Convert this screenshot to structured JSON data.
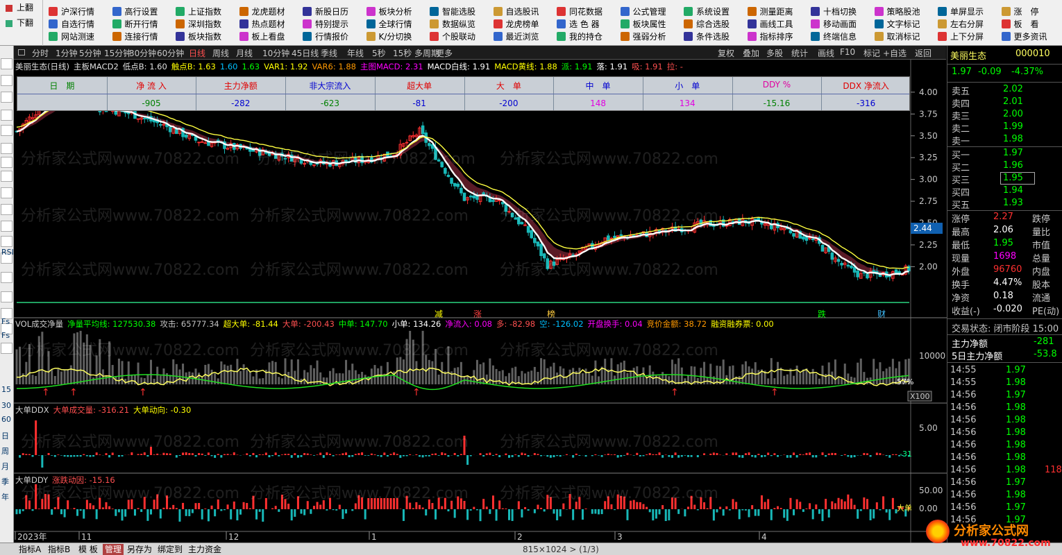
{
  "toolbar": {
    "side": [
      "上翻",
      "下翻"
    ],
    "columns": [
      [
        "沪深行情",
        "自选行情",
        "网站测速"
      ],
      [
        "高行设置",
        "断开行情",
        "连接行情"
      ],
      [
        "上证指数",
        "深圳指数",
        "板块指数"
      ],
      [
        "龙虎题材",
        "热点题材",
        "板上看盘"
      ],
      [
        "新股日历",
        "特别提示",
        "行情报价"
      ],
      [
        "板块分析",
        "全球行情",
        "K/分切换"
      ],
      [
        "智能选股",
        "数据纵览",
        "个股联动"
      ],
      [
        "自选股讯",
        "龙虎榜单",
        "最近浏览"
      ],
      [
        "同花数据",
        "选 色 器",
        "我的持仓"
      ],
      [
        "公式管理",
        "板块属性",
        "强弱分析"
      ],
      [
        "系统设置",
        "综合选股",
        "条件选股"
      ],
      [
        "测量距离",
        "画线工具",
        "指标排序"
      ],
      [
        "十档切换",
        "移动画面",
        "终端信息"
      ],
      [
        "策略股池",
        "文字标记",
        "取消标记"
      ],
      [
        "单屏显示",
        "左右分屏",
        "上下分屏"
      ],
      [
        "涨　停",
        "板　看",
        "更多资讯"
      ]
    ]
  },
  "leftbar": [
    "Fld",
    "Fzl",
    "Fzl",
    "Fzl",
    "RSI",
    "Fs",
    "Fs",
    "15",
    "30",
    "60",
    "日",
    "周",
    "月",
    "季",
    "年"
  ],
  "periods": [
    "分时",
    "1分钟",
    "5分钟",
    "15分钟",
    "30分钟",
    "60分钟",
    "日线",
    "周线",
    "月线",
    "10分钟",
    "45日线",
    "季线",
    "年线",
    "5秒",
    "15秒",
    "多周期",
    "更多"
  ],
  "periods_right": [
    "复权",
    "叠加",
    "多股",
    "统计",
    "画线",
    "F10",
    "标记",
    "+自选",
    "返回"
  ],
  "main_header": {
    "stock": "美丽生态(日线)",
    "indicator": "主板MACD2",
    "items": [
      {
        "t": "低点B: 1.60",
        "c": "#e0e0e0"
      },
      {
        "t": "触点B: 1.63",
        "c": "#ffff00"
      },
      {
        "t": "1.60",
        "c": "#00c0ff"
      },
      {
        "t": "1.63",
        "c": "#00ff00"
      },
      {
        "t": "VAR1: 1.92",
        "c": "#ffff00"
      },
      {
        "t": "VAR6: 1.88",
        "c": "#ff9900"
      },
      {
        "t": "主图MACD: 2.31",
        "c": "#ff00ff"
      },
      {
        "t": "MACD白线: 1.91",
        "c": "#ffffff"
      },
      {
        "t": "MACD黄线: 1.88",
        "c": "#ffff00"
      },
      {
        "t": "派: 1.91",
        "c": "#00ff00"
      },
      {
        "t": "落: 1.91",
        "c": "#ffffff"
      },
      {
        "t": "吸: 1.91",
        "c": "#ff5050"
      },
      {
        "t": "拉: -",
        "c": "#ff5050"
      }
    ]
  },
  "info_table": {
    "headers": [
      "日　期",
      "净 流 入",
      "主力净额",
      "非大宗流入",
      "超大单",
      "大　单",
      "中　单",
      "小　单",
      "DDY %",
      "DDX 净流入"
    ],
    "header_colors": [
      "#008000",
      "#e00000",
      "#e00000",
      "#0000d0",
      "#e00000",
      "#e00000",
      "#0000d0",
      "#0000d0",
      "#e000a0",
      "#e00000"
    ],
    "values": [
      "",
      "-905",
      "-282",
      "-623",
      "-81",
      "-200",
      "148",
      "134",
      "-15.16",
      "-316"
    ],
    "value_colors": [
      "#e00000",
      "#008000",
      "#0000d0",
      "#008000",
      "#0000d0",
      "#0000d0",
      "#e000e0",
      "#e000e0",
      "#008000",
      "#0000d0"
    ]
  },
  "chart_data": [
    {
      "type": "candlestick",
      "name": "美丽生态 日线",
      "ylim": [
        1.55,
        4.15
      ],
      "yticks": [
        "4.00",
        "3.75",
        "3.50",
        "3.25",
        "3.00",
        "2.75",
        "2.50",
        "2.25",
        "2.00"
      ],
      "x_axis_labels": [
        "2023年",
        "11",
        "12",
        "1",
        "2",
        "3",
        "4"
      ],
      "markers": [
        "减",
        "涨",
        "榜",
        "跌",
        "财"
      ],
      "price_tag": "2.44"
    },
    {
      "type": "bar",
      "name": "VOL成交净量",
      "yticks": [
        "10000"
      ],
      "right_label": "-57%",
      "scale_label": "X100"
    },
    {
      "type": "bar",
      "name": "大单DDX",
      "yticks": [
        "5.00"
      ],
      "right_label": "-31"
    },
    {
      "type": "bar",
      "name": "大单DDY",
      "yticks": [
        "50.00",
        "0.00"
      ],
      "right_label": "大单"
    }
  ],
  "vol_header": [
    {
      "t": "VOL成交净量",
      "c": "#d0d0d0"
    },
    {
      "t": "净量平均线: 127530.38",
      "c": "#00ff00"
    },
    {
      "t": "攻击: 65777.34",
      "c": "#c0c0c0"
    },
    {
      "t": "超大单: -81.44",
      "c": "#ffff00"
    },
    {
      "t": "大单: -200.43",
      "c": "#ff5050"
    },
    {
      "t": "中单: 147.70",
      "c": "#00ff00"
    },
    {
      "t": "小单: 134.26",
      "c": "#ffffff"
    },
    {
      "t": "净流入: 0.08",
      "c": "#ff00ff"
    },
    {
      "t": "多: -82.98",
      "c": "#ff5050"
    },
    {
      "t": "空: -126.02",
      "c": "#00c0ff"
    },
    {
      "t": "开盘换手: 0.04",
      "c": "#ff00ff"
    },
    {
      "t": "竞价金额: 38.72",
      "c": "#ff9900"
    },
    {
      "t": "融资融券票: 0.00",
      "c": "#ffff00"
    }
  ],
  "ddx_header": [
    {
      "t": "大单DDX",
      "c": "#d0d0d0"
    },
    {
      "t": "大单成交量: -316.21",
      "c": "#ff5050"
    },
    {
      "t": "大单动向: -0.30",
      "c": "#ffff00"
    }
  ],
  "ddy_header": [
    {
      "t": "大单DDY",
      "c": "#d0d0d0"
    },
    {
      "t": "涨跌动因: -15.16",
      "c": "#ff5050"
    }
  ],
  "quote": {
    "name": "美丽生态",
    "code": "000010",
    "price": "1.97",
    "change": "-0.09",
    "pct": "-4.37%",
    "asks": [
      [
        "卖五",
        "2.02"
      ],
      [
        "卖四",
        "2.01"
      ],
      [
        "卖三",
        "2.00"
      ],
      [
        "卖二",
        "1.99"
      ],
      [
        "卖一",
        "1.98"
      ]
    ],
    "bids": [
      [
        "买一",
        "1.97"
      ],
      [
        "买二",
        "1.96"
      ],
      [
        "买三",
        "1.95"
      ],
      [
        "买四",
        "1.94"
      ],
      [
        "买五",
        "1.93"
      ]
    ],
    "stats": [
      [
        "涨停",
        "2.27",
        "跌停"
      ],
      [
        "最高",
        "2.06",
        "量比"
      ],
      [
        "最低",
        "1.95",
        "市值"
      ],
      [
        "现量",
        "1698",
        "总量"
      ],
      [
        "外盘",
        "96760",
        "内盘"
      ],
      [
        "换手",
        "4.47%",
        "股本"
      ],
      [
        "净资",
        "0.18",
        "流通"
      ],
      [
        "收益(-)",
        "-0.020",
        "PE(动)"
      ]
    ],
    "trade_state": "交易状态: 闭市阶段 15:00",
    "flow": [
      [
        "主力净额",
        "-281"
      ],
      [
        "5日主力净额",
        "-53.8"
      ]
    ],
    "ticks": [
      [
        "14:55",
        "1.97"
      ],
      [
        "14:55",
        "1.98"
      ],
      [
        "14:56",
        "1.97"
      ],
      [
        "14:56",
        "1.98"
      ],
      [
        "14:56",
        "1.98"
      ],
      [
        "14:56",
        "1.98"
      ],
      [
        "14:56",
        "1.98"
      ],
      [
        "14:56",
        "1.98"
      ],
      [
        "14:56",
        "1.98"
      ],
      [
        "14:56",
        "1.97"
      ],
      [
        "14:56",
        "1.98"
      ],
      [
        "14:56",
        "1.97"
      ],
      [
        "14:56",
        "1.97"
      ]
    ],
    "tick_extra": "118"
  },
  "watermark": "分析家公式网www.70822.com",
  "status": {
    "tabs": [
      "指标A",
      "指标B",
      "模 板",
      "管理",
      "另存为",
      "绑定到",
      "主力资金"
    ],
    "page": "815×1024 > (1/3)",
    "logo": "分析家公式网",
    "logo_url": "www.70822.com"
  }
}
